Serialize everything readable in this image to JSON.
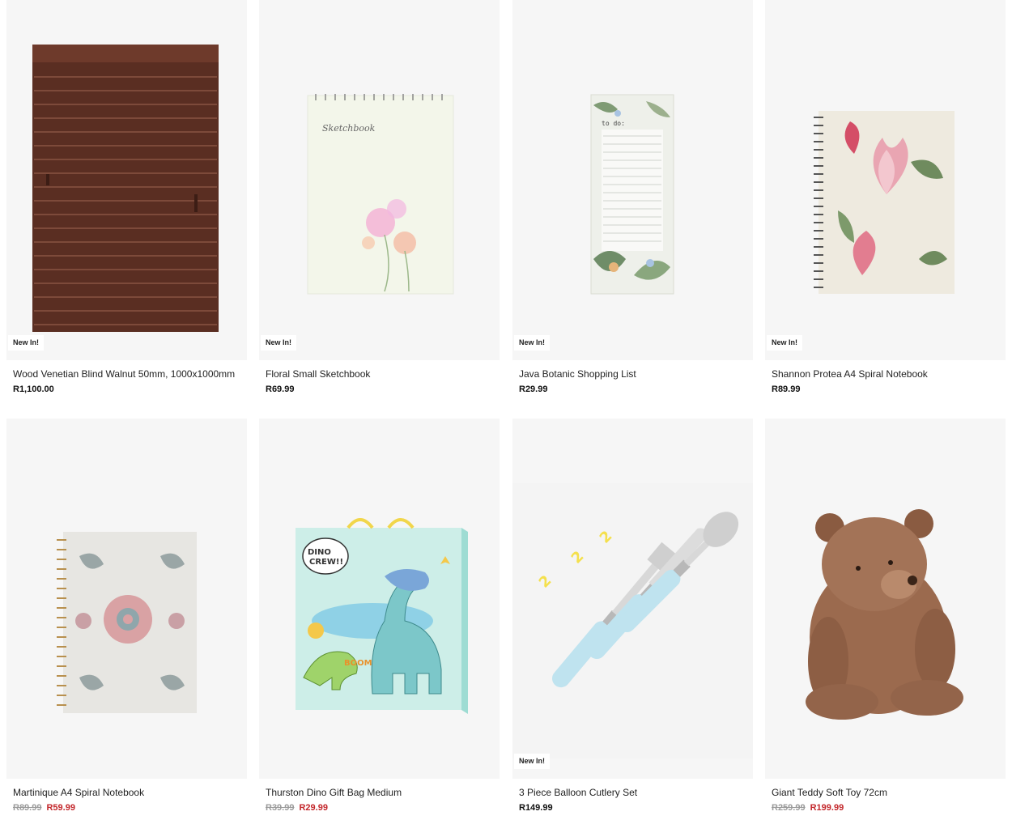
{
  "products": [
    {
      "title": "Wood Venetian Blind Walnut 50mm, 1000x1000mm",
      "price": "R1,100.00",
      "badge": "New In!"
    },
    {
      "title": "Floral Small Sketchbook",
      "price": "R69.99",
      "badge": "New In!"
    },
    {
      "title": "Java Botanic Shopping List",
      "price": "R29.99",
      "badge": "New In!"
    },
    {
      "title": "Shannon Protea A4 Spiral Notebook",
      "price": "R89.99",
      "badge": "New In!"
    },
    {
      "title": "Martinique A4 Spiral Notebook",
      "old_price": "R89.99",
      "sale_price": "R59.99"
    },
    {
      "title": "Thurston Dino Gift Bag Medium",
      "old_price": "R39.99",
      "sale_price": "R29.99"
    },
    {
      "title": "3 Piece Balloon Cutlery Set",
      "price": "R149.99",
      "badge": "New In!"
    },
    {
      "title": "Giant Teddy Soft Toy 72cm",
      "old_price": "R259.99",
      "sale_price": "R199.99"
    }
  ],
  "images": {
    "sketchbook_cover_text": "Sketchbook",
    "shopping_list_text": "to do:",
    "dino_bag_text_1": "DINO",
    "dino_bag_text_2": "CREW!!",
    "dino_bag_text_3": "BOOM"
  },
  "colors": {
    "sale": "#c3272b",
    "strike": "#9a9a9a",
    "card_bg": "#f6f6f6"
  }
}
